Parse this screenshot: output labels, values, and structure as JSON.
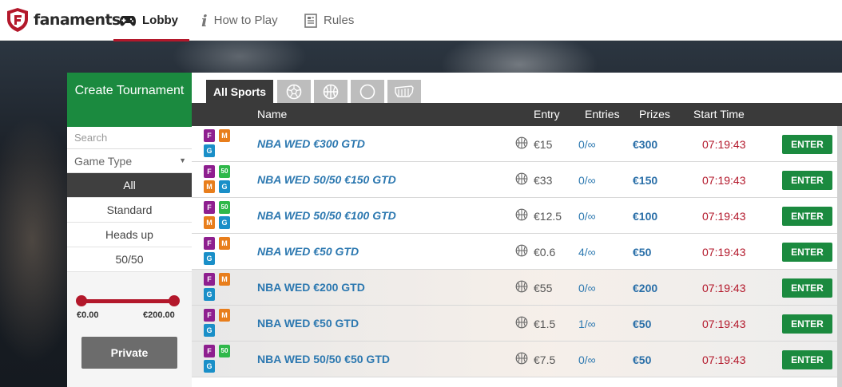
{
  "app": {
    "brand": "fanaments",
    "nav": [
      {
        "label": "Lobby",
        "icon": "gamepad-icon",
        "active": true
      },
      {
        "label": "How to Play",
        "icon": "info-icon",
        "active": false
      },
      {
        "label": "Rules",
        "icon": "rules-document-icon",
        "active": false
      }
    ]
  },
  "sidebar": {
    "create_label": "Create Tournament",
    "search_placeholder": "Search",
    "game_type_label": "Game Type",
    "filters": [
      "All",
      "Standard",
      "Heads up",
      "50/50"
    ],
    "selected_filter": "All",
    "price_min": "€0.00",
    "price_max": "€200.00",
    "private_label": "Private"
  },
  "tabs": [
    {
      "label": "All Sports",
      "active": true
    },
    {
      "icon": "soccer-ball-icon"
    },
    {
      "icon": "basketball-icon"
    },
    {
      "icon": "tennis-ball-icon"
    },
    {
      "icon": "cricket-icon"
    }
  ],
  "table": {
    "headers": {
      "name": "Name",
      "entry": "Entry",
      "entries": "Entries",
      "prizes": "Prizes",
      "start": "Start Time"
    },
    "enter_label": "ENTER",
    "rows": [
      {
        "badges": [
          "F",
          "M",
          "G"
        ],
        "name": "NBA WED €300 GTD",
        "entry": "€15",
        "entries": "0/∞",
        "prizes": "€300",
        "start": "07:19:43"
      },
      {
        "badges": [
          "F",
          "50",
          "M",
          "G"
        ],
        "name": "NBA WED 50/50 €150 GTD",
        "entry": "€33",
        "entries": "0/∞",
        "prizes": "€150",
        "start": "07:19:43"
      },
      {
        "badges": [
          "F",
          "50",
          "M",
          "G"
        ],
        "name": "NBA WED 50/50 €100 GTD",
        "entry": "€12.5",
        "entries": "0/∞",
        "prizes": "€100",
        "start": "07:19:43"
      },
      {
        "badges": [
          "F",
          "M",
          "G"
        ],
        "name": "NBA WED €50 GTD",
        "entry": "€0.6",
        "entries": "4/∞",
        "prizes": "€50",
        "start": "07:19:43"
      },
      {
        "badges": [
          "F",
          "M",
          "G"
        ],
        "name": "NBA WED €200 GTD",
        "entry": "€55",
        "entries": "0/∞",
        "prizes": "€200",
        "start": "07:19:43"
      },
      {
        "badges": [
          "F",
          "M",
          "G"
        ],
        "name": "NBA WED €50 GTD",
        "entry": "€1.5",
        "entries": "1/∞",
        "prizes": "€50",
        "start": "07:19:43"
      },
      {
        "badges": [
          "F",
          "50",
          "G"
        ],
        "name": "NBA WED 50/50 €50 GTD",
        "entry": "€7.5",
        "entries": "0/∞",
        "prizes": "€50",
        "start": "07:19:43"
      }
    ]
  },
  "colors": {
    "brand_red": "#b3182b",
    "green": "#1b8a3f",
    "badge_F": "#8e1f8f",
    "badge_M": "#e87e1c",
    "badge_G": "#1a8fc8",
    "badge_50": "#2fb84a",
    "link_blue": "#2c78b0"
  }
}
